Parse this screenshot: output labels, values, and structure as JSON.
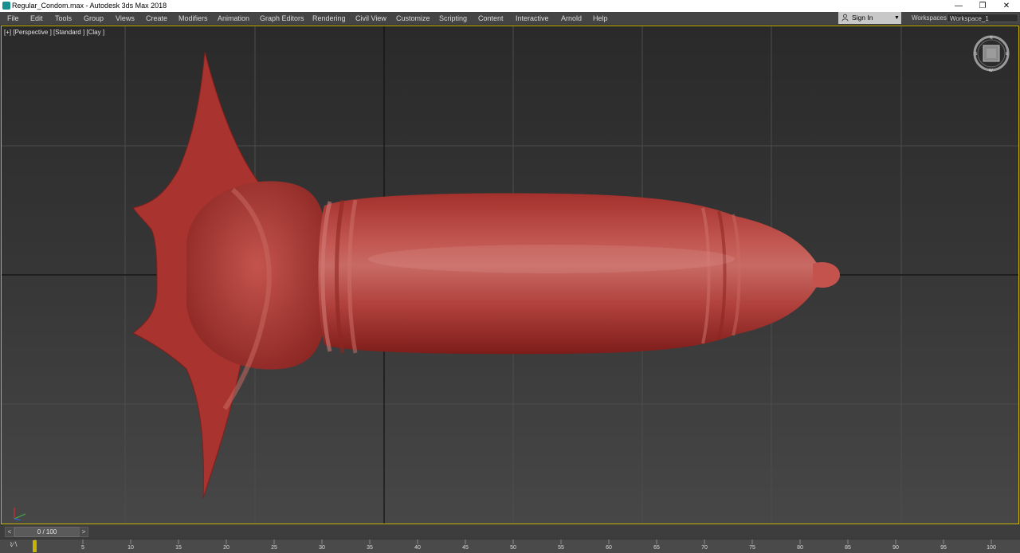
{
  "window": {
    "title": "Regular_Condom.max - Autodesk 3ds Max 2018",
    "minimize_glyph": "—",
    "restore_glyph": "❐",
    "close_glyph": "✕"
  },
  "menu": [
    "File",
    "Edit",
    "Tools",
    "Group",
    "Views",
    "Create",
    "Modifiers",
    "Animation",
    "Graph Editors",
    "Rendering",
    "Civil View",
    "Customize",
    "Scripting",
    "Content",
    "Interactive",
    "Arnold",
    "Help"
  ],
  "account": {
    "sign_in_label": "Sign In"
  },
  "workspace": {
    "label": "Workspaces:",
    "value": "Workspace_1"
  },
  "viewport": {
    "label": "[+] [Perspective ] [Standard ] [Clay ]",
    "viewcube_face": "FRONT",
    "object_color": "#c0433e",
    "accent_color": "#c8b400"
  },
  "timeline": {
    "frame_display": "0 / 100",
    "prev_glyph": "<",
    "next_glyph": ">",
    "curve_editor_label": "⌇∕∖",
    "ticks": [
      "5",
      "10",
      "15",
      "20",
      "25",
      "30",
      "35",
      "40",
      "45",
      "50",
      "55",
      "60",
      "65",
      "70",
      "75",
      "80",
      "85",
      "90",
      "95",
      "100"
    ]
  }
}
